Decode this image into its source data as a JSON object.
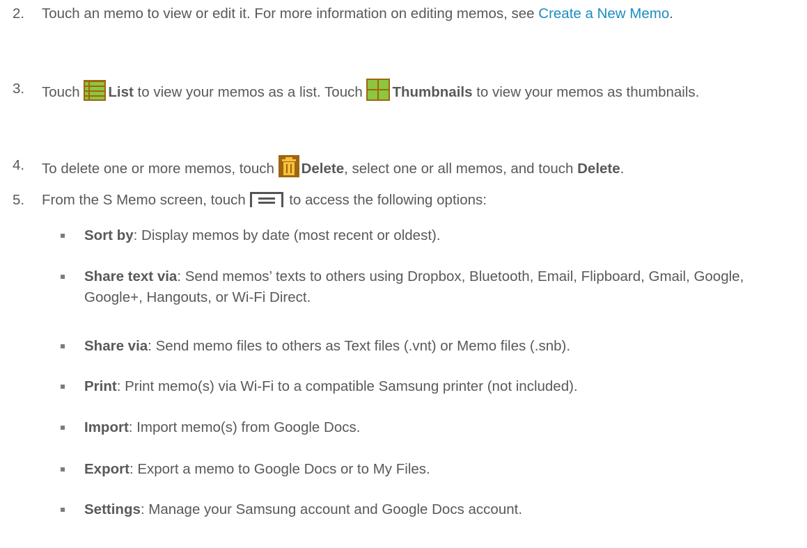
{
  "steps": [
    {
      "number": "2.",
      "text_before": "Touch an memo to view or edit it. For more information on editing memos, see ",
      "link": "Create a New Memo",
      "text_after": "."
    },
    {
      "number": "3.",
      "t1": "Touch ",
      "icon1": "list-icon",
      "bold1": "List",
      "t2": " to view your memos as a list. Touch ",
      "icon2": "thumbnails-icon",
      "bold2": "Thumbnails",
      "t3": " to view your memos as thumbnails."
    },
    {
      "number": "4.",
      "t1": "To delete one or more memos, touch ",
      "icon1": "trash-icon",
      "bold1": "Delete",
      "t2": ", select one or all memos, and touch ",
      "bold2": "Delete",
      "t3": "."
    },
    {
      "number": "5.",
      "t1": "From the S Memo screen, touch ",
      "icon1": "menu-icon",
      "t2": " to access the following options:"
    }
  ],
  "options": [
    {
      "label": "Sort by",
      "desc": ": Display memos by date (most recent or oldest)."
    },
    {
      "label": "Share text via",
      "desc": ": Send memos’ texts to others using Dropbox, Bluetooth, Email, Flipboard, Gmail, Google, Google+, Hangouts, or Wi-Fi Direct."
    },
    {
      "label": "Share via",
      "desc": ": Send memo files to others as Text files (.vnt) or Memo files (.snb)."
    },
    {
      "label": "Print",
      "desc": ": Print memo(s) via Wi-Fi to a compatible Samsung printer (not included)."
    },
    {
      "label": "Import",
      "desc": ": Import memo(s) from Google Docs."
    },
    {
      "label": "Export",
      "desc": ": Export a memo to Google Docs or to My Files."
    },
    {
      "label": "Settings",
      "desc": ": Manage your Samsung account and Google Docs account."
    }
  ],
  "colors": {
    "text": "#58595b",
    "link": "#1b8dbf",
    "icon_brown": "#a0650f",
    "icon_green": "#8dc63f"
  }
}
